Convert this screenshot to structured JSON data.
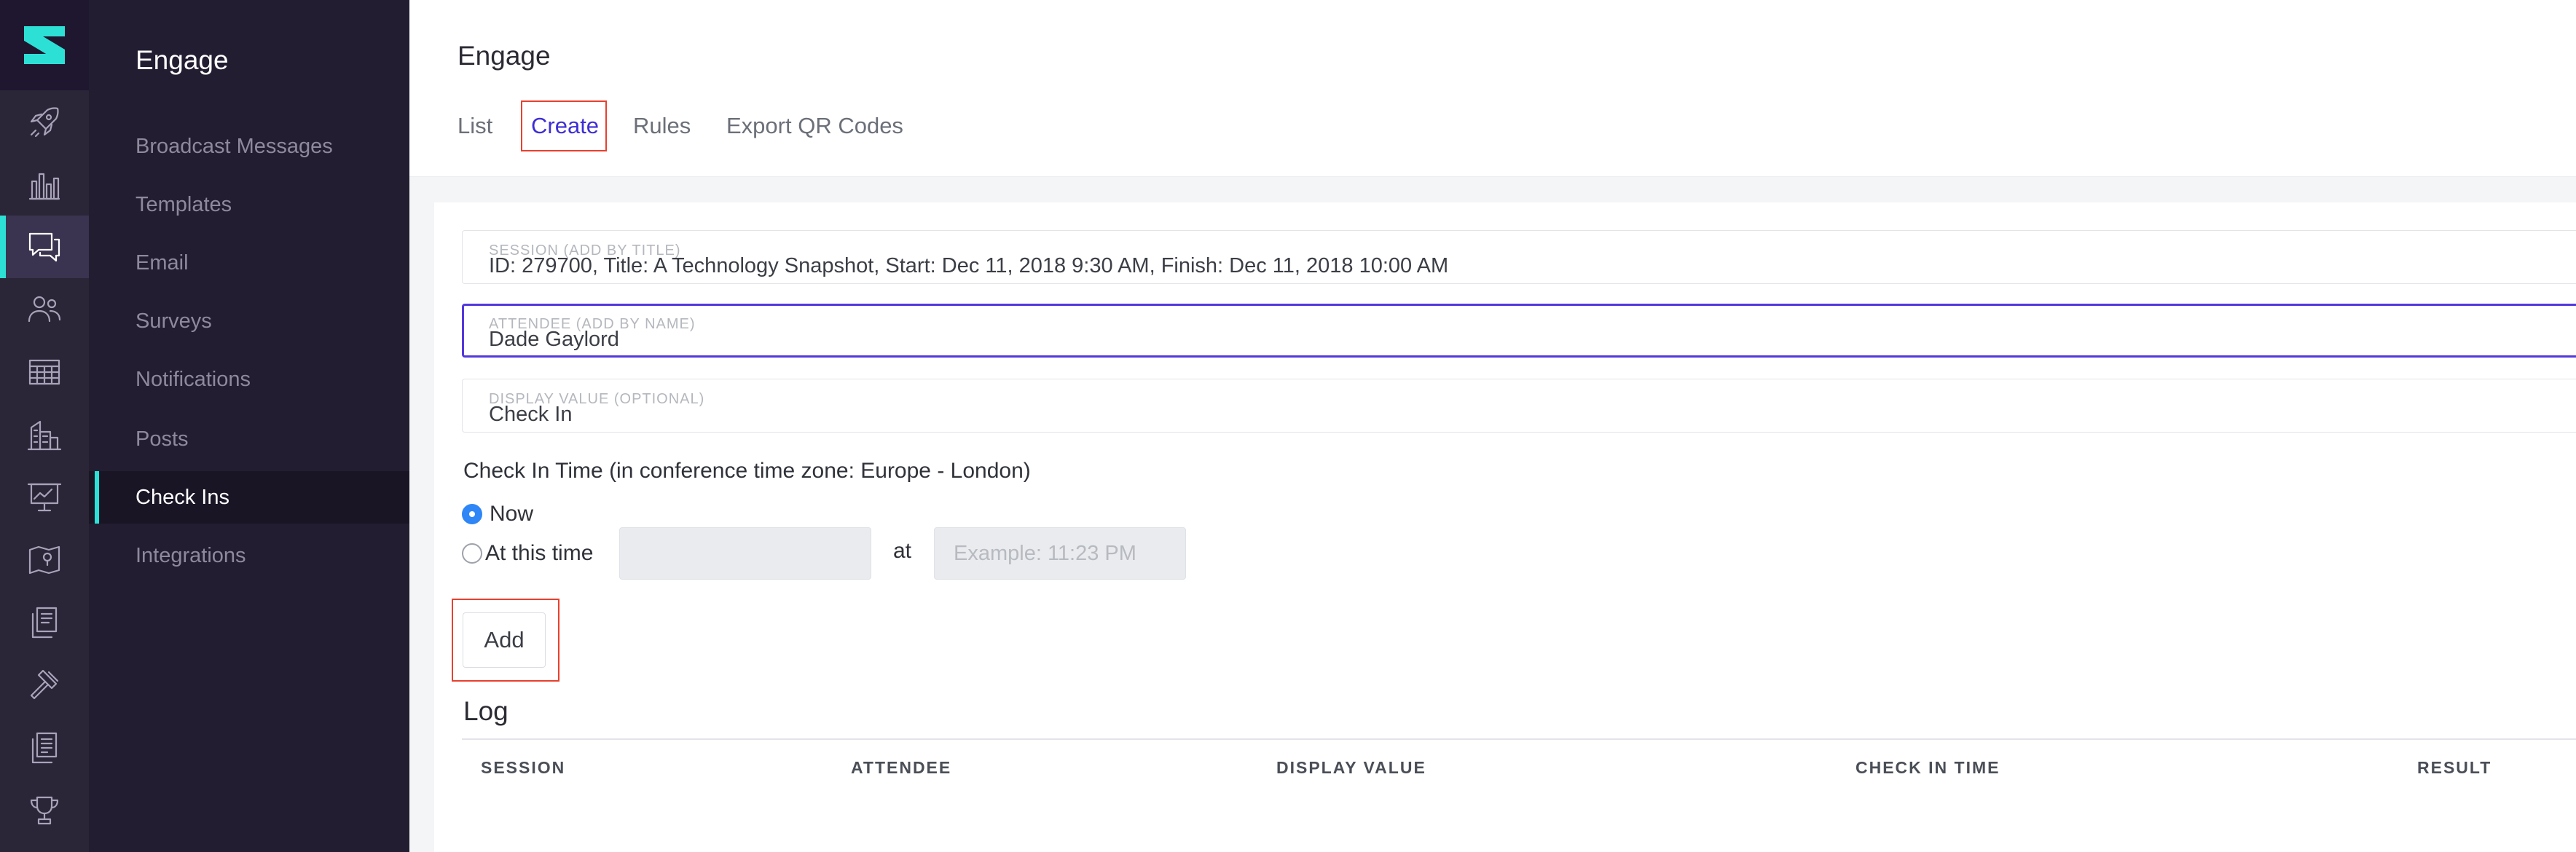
{
  "rail": {
    "icons": [
      "rocket-icon",
      "bar-chart-icon",
      "chat-bubbles-icon",
      "people-icon",
      "table-icon",
      "buildings-icon",
      "presentation-icon",
      "map-icon",
      "documents-icon",
      "gavel-icon",
      "documents-alt-icon",
      "trophy-icon"
    ],
    "active_icon": "chat-bubbles-icon",
    "accent_color": "#2de0d6"
  },
  "sidebar": {
    "title": "Engage",
    "items": [
      {
        "label": "Broadcast Messages"
      },
      {
        "label": "Templates"
      },
      {
        "label": "Email"
      },
      {
        "label": "Surveys"
      },
      {
        "label": "Notifications"
      },
      {
        "label": "Posts"
      },
      {
        "label": "Check Ins",
        "active": true
      },
      {
        "label": "Integrations"
      }
    ]
  },
  "header": {
    "title": "Engage",
    "tabs": [
      {
        "label": "List"
      },
      {
        "label": "Create",
        "active": true
      },
      {
        "label": "Rules"
      },
      {
        "label": "Export QR Codes"
      }
    ]
  },
  "form": {
    "session": {
      "label": "SESSION (ADD BY TITLE)",
      "value": "ID: 279700, Title: A Technology Snapshot, Start: Dec 11, 2018  9:30 AM, Finish: Dec 11, 2018 10:00 AM"
    },
    "attendee": {
      "label": "ATTENDEE (ADD BY NAME)",
      "value": "Dade Gaylord"
    },
    "display_value": {
      "label": "DISPLAY VALUE (OPTIONAL)",
      "value": "Check In"
    },
    "check_in_time_heading": "Check In Time (in conference time zone: Europe - London)",
    "now_label": "Now",
    "at_this_time_label": "At this time",
    "date_value": "",
    "at_label": "at",
    "time_placeholder": "Example: 11:23 PM",
    "selected_option": "Now",
    "add_label": "Add"
  },
  "log": {
    "title": "Log",
    "columns": [
      "SESSION",
      "ATTENDEE",
      "DISPLAY VALUE",
      "CHECK IN TIME",
      "RESULT"
    ]
  },
  "colors": {
    "primary": "#5438dc",
    "radio_selected": "#2f86f6",
    "highlight": "#e8402e",
    "sidebar_bg": "#221d31"
  }
}
